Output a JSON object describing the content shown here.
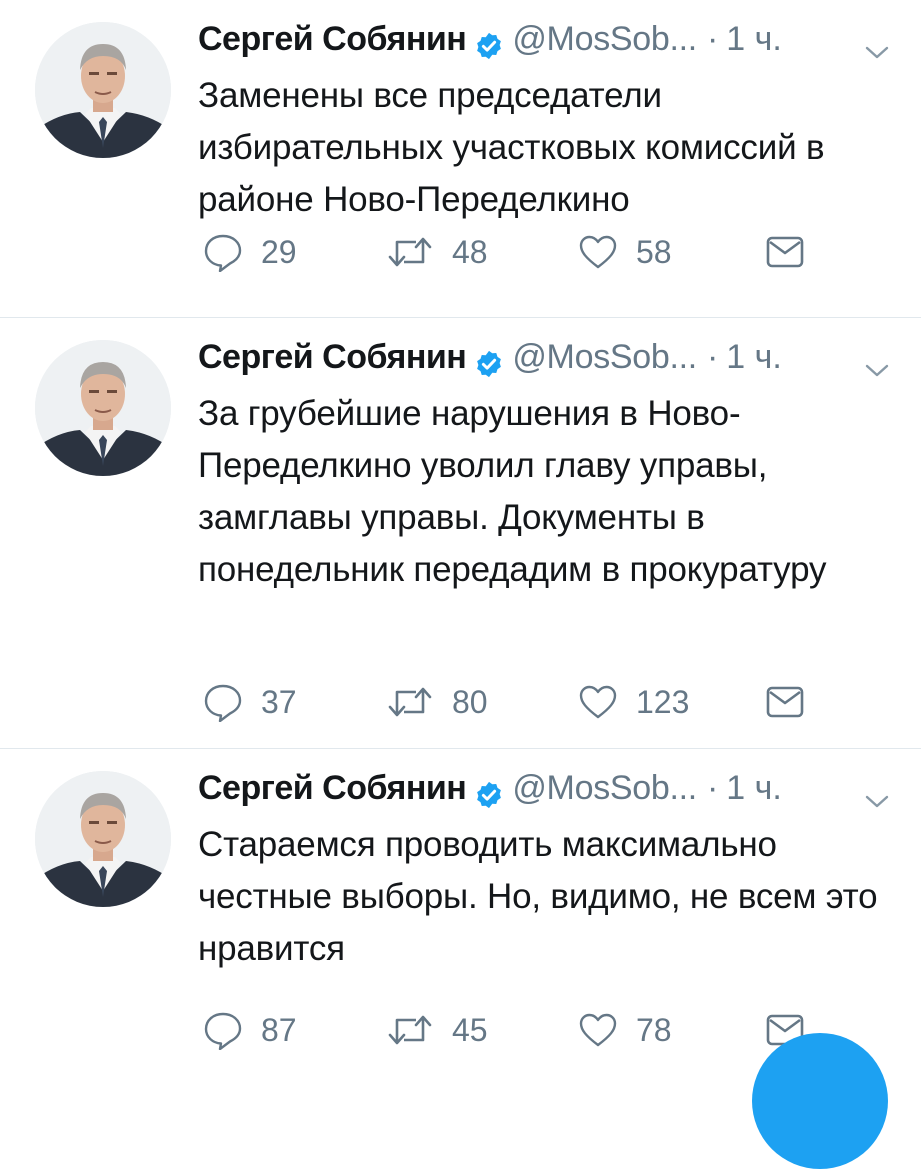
{
  "tweets": [
    {
      "name": "Сергей Собянин",
      "handle": "@MosSob...",
      "dot": "·",
      "time": "1 ч.",
      "text": "Заменены все председатели избирательных участковых комиссий в районе Ново-Переделкино",
      "replies": "29",
      "retweets": "48",
      "likes": "58"
    },
    {
      "name": "Сергей Собянин",
      "handle": "@MosSob...",
      "dot": "·",
      "time": "1 ч.",
      "text": "За грубейшие нарушения в Ново-Переделкино уволил главу управы, замглавы управы. Документы в понедельник передадим в прокуратуру",
      "replies": "37",
      "retweets": "80",
      "likes": "123"
    },
    {
      "name": "Сергей Собянин",
      "handle": "@MosSob...",
      "dot": "·",
      "time": "1 ч.",
      "text": "Стараемся проводить максимально честные выборы. Но, видимо, не всем это нравится",
      "replies": "87",
      "retweets": "45",
      "likes": "78"
    }
  ],
  "colors": {
    "accent": "#1da1f2",
    "muted": "#657786",
    "text": "#14171a",
    "divider": "#e1e8ed"
  },
  "icons": {
    "verified": "verified-badge-icon",
    "menu": "chevron-down-icon",
    "reply": "reply-icon",
    "retweet": "retweet-icon",
    "like": "heart-icon",
    "dm": "envelope-icon",
    "compose": "compose-fab"
  }
}
